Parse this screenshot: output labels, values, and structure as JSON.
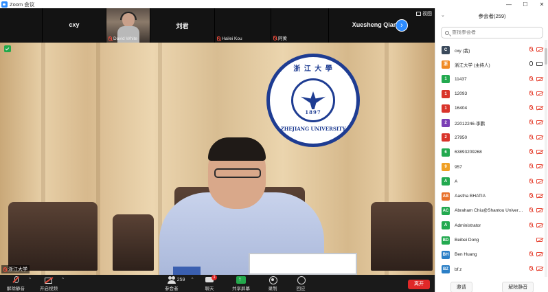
{
  "window": {
    "title": "Zoom 会议",
    "controls": [
      "—",
      "☐",
      "✕"
    ]
  },
  "thumbnails": [
    {
      "name": "",
      "type": "blank"
    },
    {
      "name": "cxy",
      "type": "name"
    },
    {
      "name": "David White",
      "type": "photo"
    },
    {
      "name": "刘君",
      "type": "name"
    },
    {
      "name": "Hailei Kou",
      "type": "blank"
    },
    {
      "name": "阿黄",
      "type": "blank"
    },
    {
      "name": "Xuesheng Qian",
      "type": "name"
    }
  ],
  "gallery_toggle": "视图",
  "main_video": {
    "speaker_label": "浙江大学",
    "logo_text_top": "浙 江 大 學",
    "logo_year": "1897",
    "logo_text_bottom": "ZHEJIANG UNIVERSITY"
  },
  "toolbar": {
    "mute": "解除静音",
    "video": "开启视频",
    "participants": "参会者",
    "participants_count": "259",
    "chat": "聊天",
    "chat_badge": "1",
    "share": "共享屏幕",
    "record": "录制",
    "reactions": "回应",
    "leave": "离开"
  },
  "panel": {
    "title": "参会者(259)",
    "search_placeholder": "查找参会者",
    "participants": [
      {
        "initial": "C",
        "color": "#3b4a5c",
        "name": "cxy (我)",
        "mic": "off",
        "cam": "off"
      },
      {
        "initial": "浙",
        "color": "#f08a24",
        "name": "浙江大学 (主持人)",
        "mic": "on",
        "cam": "on"
      },
      {
        "initial": "1",
        "color": "#22a94f",
        "name": "11437",
        "mic": "off",
        "cam": "off"
      },
      {
        "initial": "1",
        "color": "#d9342b",
        "name": "12093",
        "mic": "off",
        "cam": "off"
      },
      {
        "initial": "1",
        "color": "#d9342b",
        "name": "16404",
        "mic": "off",
        "cam": "off"
      },
      {
        "initial": "2",
        "color": "#7b3fb5",
        "name": "22012246-李鹏",
        "mic": "off",
        "cam": "off"
      },
      {
        "initial": "2",
        "color": "#d9342b",
        "name": "27950",
        "mic": "off",
        "cam": "off"
      },
      {
        "initial": "6",
        "color": "#22a94f",
        "name": "63893209268",
        "mic": "off",
        "cam": "off"
      },
      {
        "initial": "9",
        "color": "#f0a024",
        "name": "957",
        "mic": "off",
        "cam": "off"
      },
      {
        "initial": "A",
        "color": "#22a94f",
        "name": "A",
        "mic": "off",
        "cam": "off"
      },
      {
        "initial": "AB",
        "color": "#e8702a",
        "name": "Aastha BHATIA",
        "mic": "off",
        "cam": "off"
      },
      {
        "initial": "AC",
        "color": "#22a94f",
        "name": "Abraham Chiu@Shantou Univers...",
        "mic": "off",
        "cam": "off"
      },
      {
        "initial": "A",
        "color": "#22a94f",
        "name": "Administrator",
        "mic": "off",
        "cam": "off"
      },
      {
        "initial": "BD",
        "color": "#22a94f",
        "name": "Beibei Dong",
        "mic": "none",
        "cam": "off"
      },
      {
        "initial": "BH",
        "color": "#2b7fc6",
        "name": "Ben Huang",
        "mic": "off",
        "cam": "off"
      },
      {
        "initial": "BZ",
        "color": "#2b7fc6",
        "name": "bf.z",
        "mic": "off",
        "cam": "off"
      }
    ],
    "footer": {
      "invite": "邀请",
      "unmute_all": "解除静音"
    }
  }
}
